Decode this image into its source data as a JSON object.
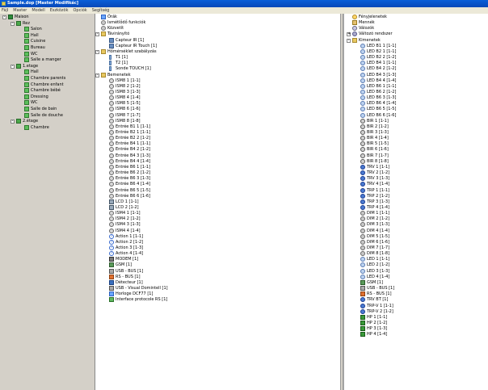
{
  "window": {
    "title": "Sample.dop [Master Modifikác]"
  },
  "menu": [
    "Fájl",
    "Master",
    "Modell",
    "Eszközök",
    "Opciók",
    "Segítség"
  ],
  "left_tree": [
    {
      "d": 0,
      "e": "-",
      "k": "house",
      "t": "Maison"
    },
    {
      "d": 1,
      "e": "-",
      "k": "floor",
      "t": "Rez"
    },
    {
      "d": 2,
      "k": "room",
      "t": "Salon"
    },
    {
      "d": 2,
      "k": "room",
      "t": "Hall"
    },
    {
      "d": 2,
      "k": "room",
      "t": "Cuisine"
    },
    {
      "d": 2,
      "k": "room",
      "t": "Bureau"
    },
    {
      "d": 2,
      "k": "room",
      "t": "WC"
    },
    {
      "d": 2,
      "k": "room",
      "t": "Salle a manger"
    },
    {
      "d": 1,
      "e": "-",
      "k": "floor",
      "t": "1.etage"
    },
    {
      "d": 2,
      "k": "room",
      "t": "Hall"
    },
    {
      "d": 2,
      "k": "room",
      "t": "Chambre parents"
    },
    {
      "d": 2,
      "k": "room",
      "t": "Chambre enfant"
    },
    {
      "d": 2,
      "k": "room",
      "t": "Chambre bébé"
    },
    {
      "d": 2,
      "k": "room",
      "t": "Dressing"
    },
    {
      "d": 2,
      "k": "room",
      "t": "WC"
    },
    {
      "d": 2,
      "k": "room",
      "t": "Salle de bain"
    },
    {
      "d": 2,
      "k": "room",
      "t": "Salle de douche"
    },
    {
      "d": 1,
      "e": "-",
      "k": "floor",
      "t": "2.étage"
    },
    {
      "d": 2,
      "k": "room",
      "t": "Chambre"
    }
  ],
  "mid_tree": [
    {
      "d": 0,
      "k": "clock",
      "t": "Órák"
    },
    {
      "d": 0,
      "k": "gear",
      "t": "Ismétlődő funkciók"
    },
    {
      "d": 0,
      "k": "gear",
      "t": "Közvetít"
    },
    {
      "d": 0,
      "e": "-",
      "k": "folder",
      "t": "Távirányító"
    },
    {
      "d": 1,
      "k": "pc",
      "t": "Capteur IR [1]"
    },
    {
      "d": 1,
      "k": "pc",
      "t": "Capteur IR Touch [1]"
    },
    {
      "d": 0,
      "e": "-",
      "k": "folder",
      "t": "Hőmérséklet szabályzás"
    },
    {
      "d": 1,
      "k": "therm",
      "t": "T1 [1]"
    },
    {
      "d": 1,
      "k": "therm",
      "t": "T2 [1]"
    },
    {
      "d": 1,
      "k": "therm",
      "t": "Sonde TOUCH [1]"
    },
    {
      "d": 0,
      "e": "-",
      "k": "folder",
      "t": "Bemenetek"
    },
    {
      "d": 1,
      "k": "circle",
      "t": "ISM8 1 [1-1]"
    },
    {
      "d": 1,
      "k": "circle",
      "t": "ISM8 2 [1-2]"
    },
    {
      "d": 1,
      "k": "circle",
      "t": "ISM8 3 [1-3]"
    },
    {
      "d": 1,
      "k": "circle",
      "t": "ISM8 4 [1-4]"
    },
    {
      "d": 1,
      "k": "circle",
      "t": "ISM8 5 [1-5]"
    },
    {
      "d": 1,
      "k": "circle",
      "t": "ISM8 6 [1-6]"
    },
    {
      "d": 1,
      "k": "circle",
      "t": "ISM8 7 [1-7]"
    },
    {
      "d": 1,
      "k": "circle",
      "t": "ISM8 8 [1-8]"
    },
    {
      "d": 1,
      "k": "circle",
      "t": "Entrée B1 1 [1-1]"
    },
    {
      "d": 1,
      "k": "circle",
      "t": "Entrée B2 1 [1-1]"
    },
    {
      "d": 1,
      "k": "circle",
      "t": "Entrée B2 2 [1-2]"
    },
    {
      "d": 1,
      "k": "circle",
      "t": "Entrée B4 1 [1-1]"
    },
    {
      "d": 1,
      "k": "circle",
      "t": "Entrée B4 2 [1-2]"
    },
    {
      "d": 1,
      "k": "circle",
      "t": "Entrée B4 3 [1-3]"
    },
    {
      "d": 1,
      "k": "circle",
      "t": "Entrée B4 4 [1-4]"
    },
    {
      "d": 1,
      "k": "circle",
      "t": "Entrée B6 1 [1-1]"
    },
    {
      "d": 1,
      "k": "circle",
      "t": "Entrée B6 2 [1-2]"
    },
    {
      "d": 1,
      "k": "circle",
      "t": "Entrée B6 3 [1-3]"
    },
    {
      "d": 1,
      "k": "circle",
      "t": "Entrée B6 4 [1-4]"
    },
    {
      "d": 1,
      "k": "circle",
      "t": "Entrée B6 5 [1-5]"
    },
    {
      "d": 1,
      "k": "circle",
      "t": "Entrée B6 6 [1-6]"
    },
    {
      "d": 1,
      "k": "lcd",
      "t": "LCD 1 [1-1]"
    },
    {
      "d": 1,
      "k": "lcd",
      "t": "LCD 2 [1-2]"
    },
    {
      "d": 1,
      "k": "circle",
      "t": "ISM4 1 [1-1]"
    },
    {
      "d": 1,
      "k": "circle",
      "t": "ISM4 2 [1-2]"
    },
    {
      "d": 1,
      "k": "circle",
      "t": "ISM4 3 [1-3]"
    },
    {
      "d": 1,
      "k": "circle",
      "t": "ISM4 4 [1-4]"
    },
    {
      "d": 1,
      "k": "action",
      "t": "Action 1 [1-1]"
    },
    {
      "d": 1,
      "k": "action",
      "t": "Action 2 [1-2]"
    },
    {
      "d": 1,
      "k": "action",
      "t": "Action 3 [1-3]"
    },
    {
      "d": 1,
      "k": "action",
      "t": "Action 4 [1-4]"
    },
    {
      "d": 1,
      "k": "modem",
      "t": "MODEM [1]"
    },
    {
      "d": 1,
      "k": "gsm",
      "t": "GSM [1]"
    },
    {
      "d": 1,
      "k": "usb",
      "t": "USB - BUS [1]"
    },
    {
      "d": 1,
      "k": "rs",
      "t": "RS - BUS [1]"
    },
    {
      "d": 1,
      "k": "detect",
      "t": "Détecteur [1]"
    },
    {
      "d": 1,
      "k": "usb",
      "t": "USB - Visual Domintell [1]"
    },
    {
      "d": 1,
      "k": "clock",
      "t": "Horloge DCF77 [1]"
    },
    {
      "d": 1,
      "k": "iface",
      "t": "Interface protocole RS [1]"
    }
  ],
  "right_tree": [
    {
      "d": 0,
      "k": "sun",
      "t": "Fényjelenetek"
    },
    {
      "d": 0,
      "k": "shade",
      "t": "Mennék"
    },
    {
      "d": 0,
      "k": "valve",
      "t": "Válozók"
    },
    {
      "d": 0,
      "e": "+",
      "k": "var",
      "t": "Változó rendszer"
    },
    {
      "d": 0,
      "e": "-",
      "k": "folder",
      "t": "Kimenetek"
    },
    {
      "d": 1,
      "k": "led",
      "t": "LED B1 1 [1-1]"
    },
    {
      "d": 1,
      "k": "led",
      "t": "LED B2 1 [1-1]"
    },
    {
      "d": 1,
      "k": "led",
      "t": "LED B2 2 [1-2]"
    },
    {
      "d": 1,
      "k": "led",
      "t": "LED B4 1 [1-1]"
    },
    {
      "d": 1,
      "k": "led",
      "t": "LED B4 2 [1-2]"
    },
    {
      "d": 1,
      "k": "led",
      "t": "LED B4 3 [1-3]"
    },
    {
      "d": 1,
      "k": "led",
      "t": "LED B4 4 [1-4]"
    },
    {
      "d": 1,
      "k": "led",
      "t": "LED B6 1 [1-1]"
    },
    {
      "d": 1,
      "k": "led",
      "t": "LED B6 2 [1-2]"
    },
    {
      "d": 1,
      "k": "led",
      "t": "LED B6 3 [1-3]"
    },
    {
      "d": 1,
      "k": "led",
      "t": "LED B6 4 [1-4]"
    },
    {
      "d": 1,
      "k": "led",
      "t": "LED B6 5 [1-5]"
    },
    {
      "d": 1,
      "k": "led",
      "t": "LED B6 6 [1-6]"
    },
    {
      "d": 1,
      "k": "bir",
      "t": "BIR 1 [1-1]"
    },
    {
      "d": 1,
      "k": "bir",
      "t": "BIR 2 [1-2]"
    },
    {
      "d": 1,
      "k": "bir",
      "t": "BIR 3 [1-3]"
    },
    {
      "d": 1,
      "k": "bir",
      "t": "BIR 4 [1-4]"
    },
    {
      "d": 1,
      "k": "bir",
      "t": "BIR 5 [1-5]"
    },
    {
      "d": 1,
      "k": "bir",
      "t": "BIR 6 [1-6]"
    },
    {
      "d": 1,
      "k": "bir",
      "t": "BIR 7 [1-7]"
    },
    {
      "d": 1,
      "k": "bir",
      "t": "BIR 8 [1-8]"
    },
    {
      "d": 1,
      "k": "trv",
      "t": "TRV 1 [1-1]"
    },
    {
      "d": 1,
      "k": "trv",
      "t": "TRV 2 [1-2]"
    },
    {
      "d": 1,
      "k": "trv",
      "t": "TRV 3 [1-3]"
    },
    {
      "d": 1,
      "k": "trv",
      "t": "TRV 4 [1-4]"
    },
    {
      "d": 1,
      "k": "trv",
      "t": "TRP 1 [1-1]"
    },
    {
      "d": 1,
      "k": "trv",
      "t": "TRP 2 [1-2]"
    },
    {
      "d": 1,
      "k": "trv",
      "t": "TRP 3 [1-3]"
    },
    {
      "d": 1,
      "k": "trv",
      "t": "TRP 4 [1-4]"
    },
    {
      "d": 1,
      "k": "dim",
      "t": "DIM 1 [1-1]"
    },
    {
      "d": 1,
      "k": "dim",
      "t": "DIM 2 [1-2]"
    },
    {
      "d": 1,
      "k": "dim",
      "t": "DIM 3 [1-3]"
    },
    {
      "d": 1,
      "k": "dim",
      "t": "DIM 4 [1-4]"
    },
    {
      "d": 1,
      "k": "dim",
      "t": "DIM 5 [1-5]"
    },
    {
      "d": 1,
      "k": "dim",
      "t": "DIM 6 [1-6]"
    },
    {
      "d": 1,
      "k": "dim",
      "t": "DIM 7 [1-7]"
    },
    {
      "d": 1,
      "k": "dim",
      "t": "DIM 8 [1-8]"
    },
    {
      "d": 1,
      "k": "led",
      "t": "LED 1 [1-1]"
    },
    {
      "d": 1,
      "k": "led",
      "t": "LED 2 [1-2]"
    },
    {
      "d": 1,
      "k": "led",
      "t": "LED 3 [1-3]"
    },
    {
      "d": 1,
      "k": "led",
      "t": "LED 4 [1-4]"
    },
    {
      "d": 1,
      "k": "gsm",
      "t": "GSM [1]"
    },
    {
      "d": 1,
      "k": "usb",
      "t": "USB - BUS [1]"
    },
    {
      "d": 1,
      "k": "rs",
      "t": "RS - BUS [1]"
    },
    {
      "d": 1,
      "k": "trv",
      "t": "TRV BT [1]"
    },
    {
      "d": 1,
      "k": "trv",
      "t": "TRP-V 1 [1-1]"
    },
    {
      "d": 1,
      "k": "trv",
      "t": "TRP-V 2 [1-2]"
    },
    {
      "d": 1,
      "k": "hp",
      "t": "HP 1 [1-1]"
    },
    {
      "d": 1,
      "k": "hp",
      "t": "HP 2 [1-2]"
    },
    {
      "d": 1,
      "k": "hp",
      "t": "HP 3 [1-3]"
    },
    {
      "d": 1,
      "k": "hp",
      "t": "HP 4 [1-4]"
    }
  ]
}
